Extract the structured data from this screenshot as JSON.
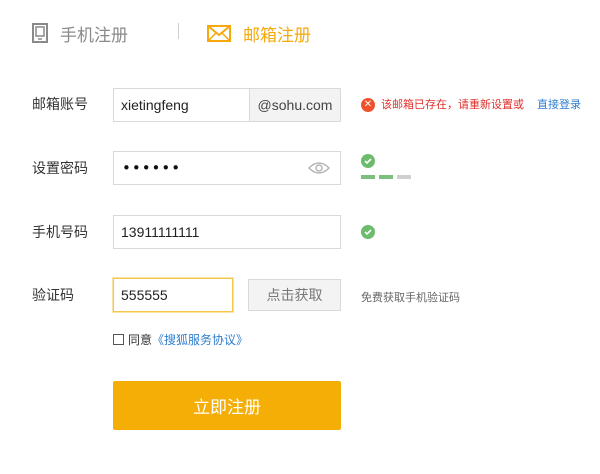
{
  "tabs": {
    "phone_label": "手机注册",
    "email_label": "邮箱注册"
  },
  "form": {
    "email": {
      "label": "邮箱账号",
      "value": "xietingfeng",
      "suffix": "@sohu.com",
      "error": "该邮箱已存在，请重新设置或",
      "error_link": "直接登录"
    },
    "password": {
      "label": "设置密码",
      "value": "••••••"
    },
    "phone": {
      "label": "手机号码",
      "value": "13911111111"
    },
    "code": {
      "label": "验证码",
      "value": "555555",
      "button": "点击获取",
      "hint": "免费获取手机验证码"
    }
  },
  "agreement": {
    "prefix": "同意",
    "link": "《搜狐服务协议》"
  },
  "submit_label": "立即注册",
  "colors": {
    "accent": "#f5ae06",
    "error": "#e0302c",
    "success": "#6cbc6c",
    "link": "#2e7dd1"
  }
}
